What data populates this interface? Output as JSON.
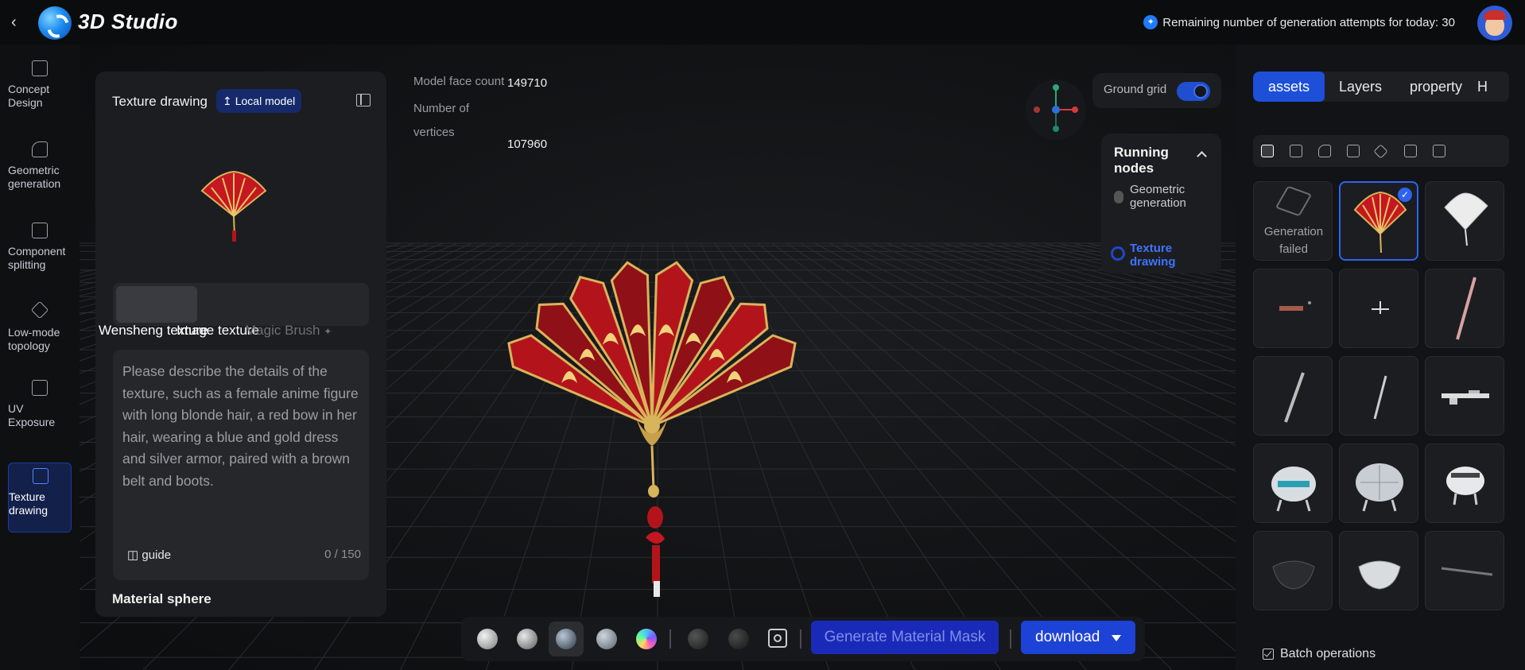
{
  "header": {
    "app_title": "3D Studio",
    "remaining_text": "Remaining number of generation attempts for today: 30",
    "remaining_icon": "sparkle-icon"
  },
  "leftnav": {
    "items": [
      {
        "label": "Concept Design",
        "icon": "image-edit-icon",
        "active": false
      },
      {
        "label": "Geometric generation",
        "icon": "shapes-icon",
        "active": false
      },
      {
        "label": "Component splitting",
        "icon": "split-icon",
        "active": false
      },
      {
        "label": "Low-mode topology",
        "icon": "topology-icon",
        "active": false
      },
      {
        "label": "UV Exposure",
        "icon": "uv-icon",
        "active": false
      },
      {
        "label": "Texture drawing",
        "icon": "texture-icon",
        "active": true
      }
    ]
  },
  "panel": {
    "title": "Texture drawing",
    "local_model": "Local model",
    "tabs": [
      "Wensheng texture",
      "Image texture",
      "Magic Brush"
    ],
    "prompt_placeholder": "Please describe the details of the texture, such as a female anime figure with long blonde hair, a red bow in her hair, wearing a blue and gold dress and silver armor, paired with a brown belt and boots.",
    "guide": "guide",
    "counter": "0 / 150",
    "material_title": "Material sphere"
  },
  "stats": {
    "face_label": "Model face count",
    "face_value": "149710",
    "vert_label": "Number of vertices",
    "vert_value": "107960"
  },
  "ground": {
    "label": "Ground grid",
    "enabled": true
  },
  "nodes": {
    "title": "Running nodes",
    "items": [
      {
        "label": "Geometric generation",
        "state": "done"
      },
      {
        "label": "Texture drawing",
        "state": "running"
      }
    ]
  },
  "toolbar": {
    "generate_mask": "Generate Material Mask",
    "download": "download"
  },
  "rightpanel": {
    "tabs": [
      "assets",
      "Layers",
      "property",
      "H"
    ],
    "active_tab": "assets",
    "assets": [
      {
        "type": "failed",
        "label": "Generation failed"
      },
      {
        "type": "fan",
        "selected": true
      },
      {
        "type": "white-fan"
      },
      {
        "type": "small-object"
      },
      {
        "type": "cross"
      },
      {
        "type": "blade-pink"
      },
      {
        "type": "blade"
      },
      {
        "type": "blade-thin"
      },
      {
        "type": "rifle"
      },
      {
        "type": "drone-a"
      },
      {
        "type": "drone-b"
      },
      {
        "type": "drone-c"
      },
      {
        "type": "mask-dark"
      },
      {
        "type": "mask-light"
      },
      {
        "type": "knife"
      }
    ],
    "batch": "Batch operations"
  },
  "colors": {
    "accent": "#1d4fd8",
    "fan_red": "#b3141c",
    "fan_gold": "#d8b45a"
  }
}
